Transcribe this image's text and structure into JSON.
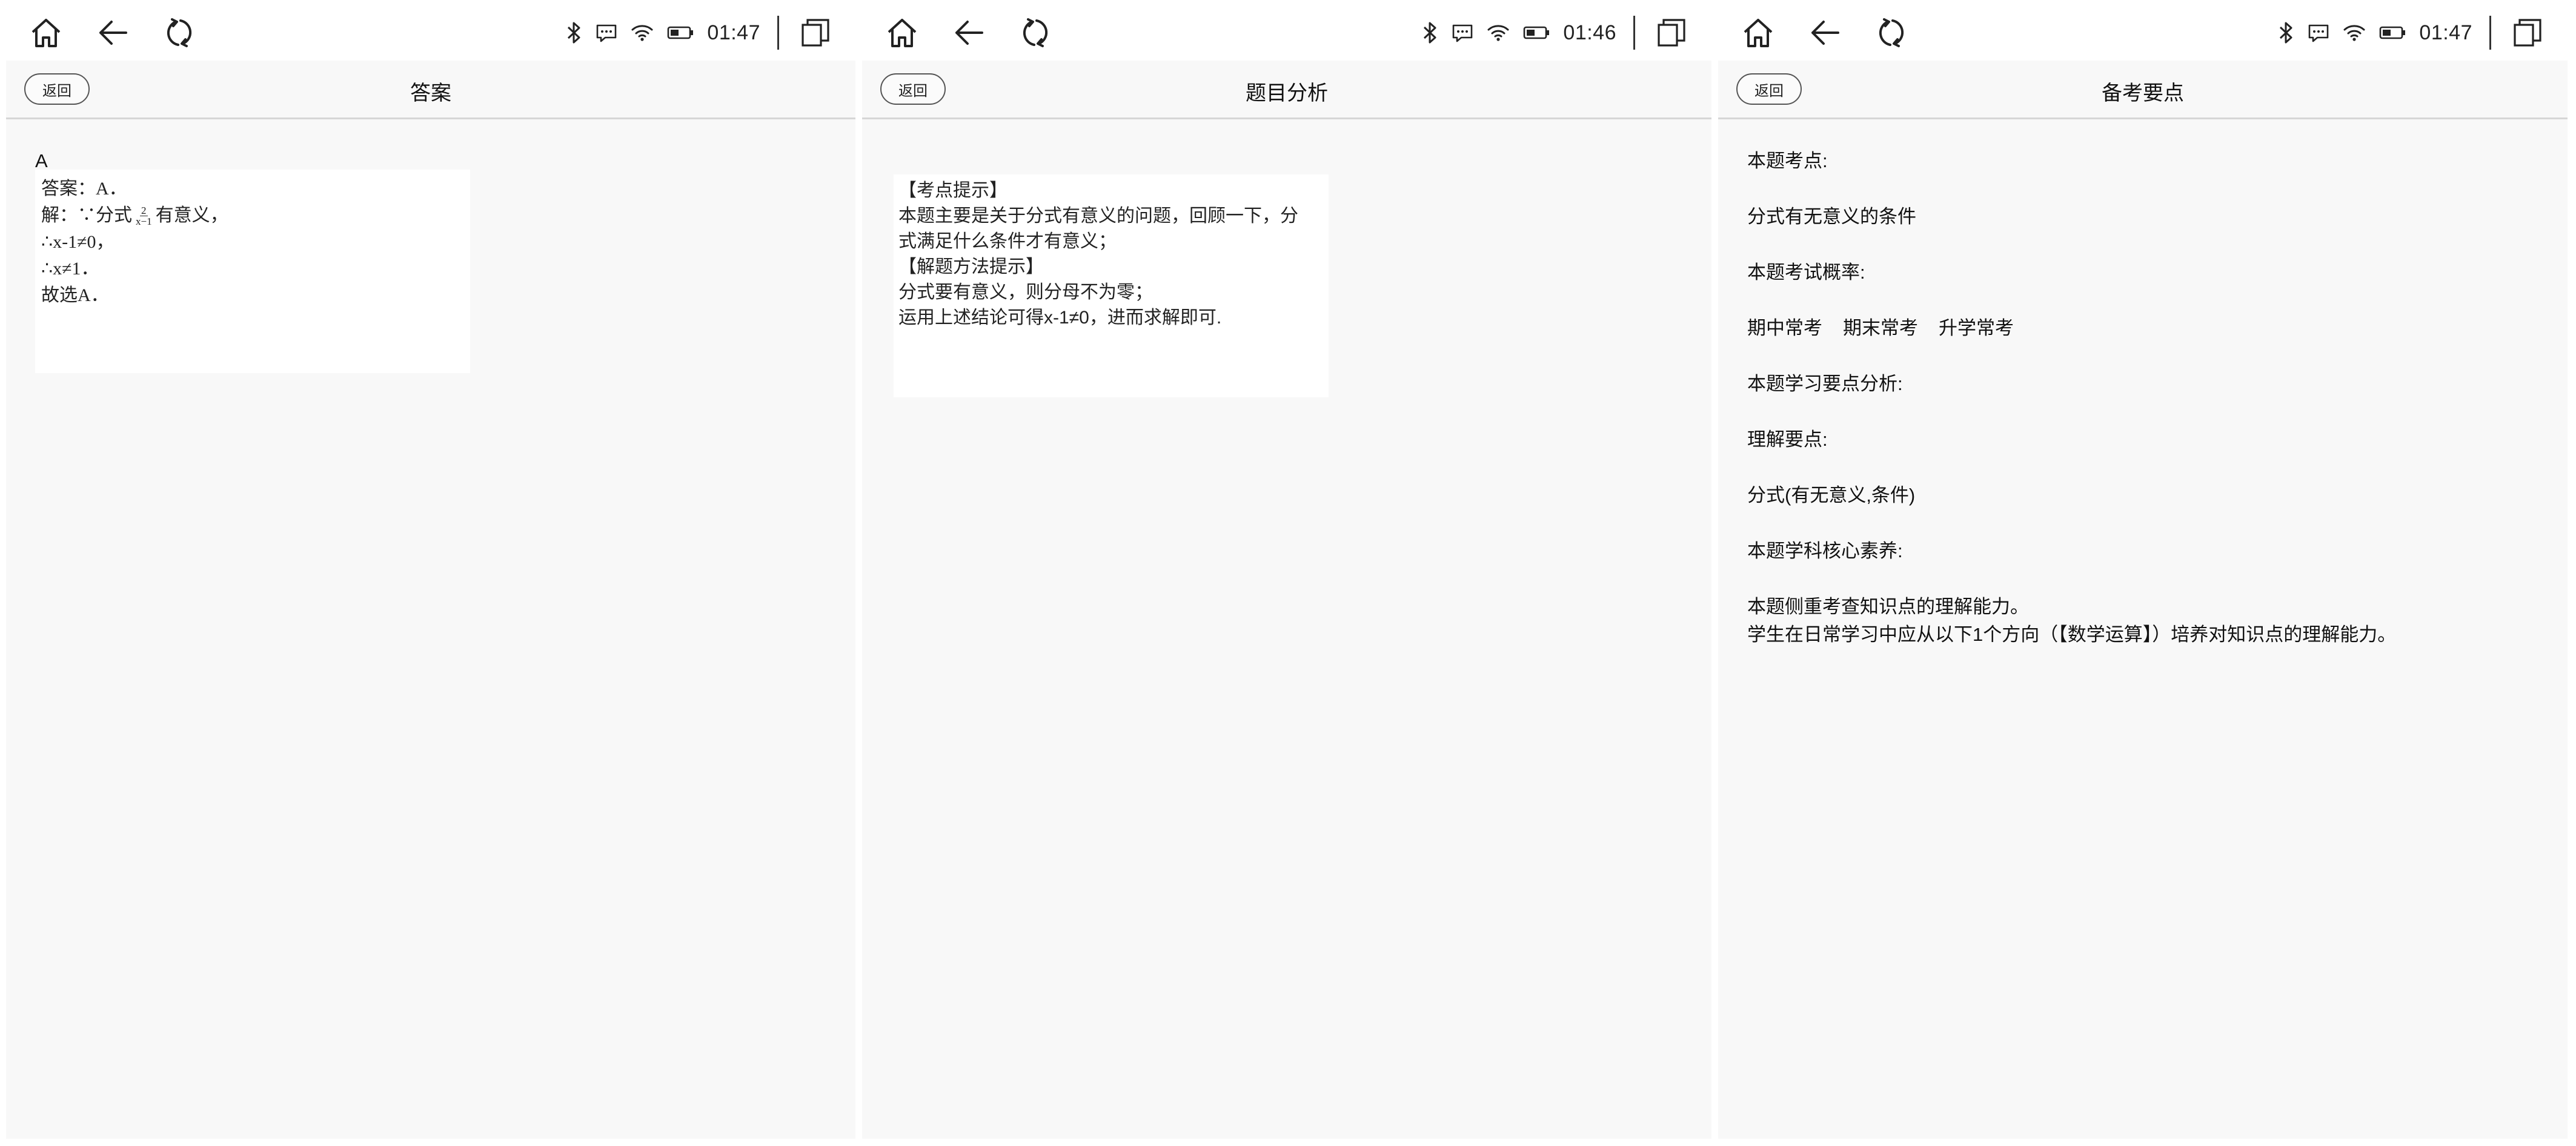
{
  "status_bar": {
    "panels": [
      {
        "time": "01:47"
      },
      {
        "time": "01:46"
      },
      {
        "time": "01:47"
      }
    ]
  },
  "common": {
    "back_label": "返回"
  },
  "panel1": {
    "title": "答案",
    "answer_letter": "A",
    "lines": {
      "answer": "答案：A．",
      "solve_prefix": "解：∵分式",
      "frac_num": "2",
      "frac_den": "x−1",
      "solve_suffix": "有意义，",
      "step1": "∴x-1≠0，",
      "step2": "∴x≠1．",
      "conclusion": "故选A．"
    }
  },
  "panel2": {
    "title": "题目分析",
    "lines": [
      "【考点提示】",
      "本题主要是关于分式有意义的问题，回顾一下，分",
      "式满足什么条件才有意义；",
      "【解题方法提示】",
      "分式要有意义，则分母不为零；",
      "运用上述结论可得x-1≠0，进而求解即可."
    ]
  },
  "panel3": {
    "title": "备考要点",
    "key_point_heading": "本题考点:",
    "key_point": "分式有无意义的条件",
    "probability_heading": "本题考试概率:",
    "probabilities": [
      "期中常考",
      "期末常考",
      "升学常考"
    ],
    "study_heading": "本题学习要点分析:",
    "understanding_heading": "理解要点:",
    "understanding": "分式(有无意义,条件)",
    "literacy_heading": "本题学科核心素养:",
    "literacy_line1": "本题侧重考查知识点的理解能力。",
    "literacy_line2": "学生在日常学习中应从以下1个方向（【数学运算】）培养对知识点的理解能力。"
  }
}
